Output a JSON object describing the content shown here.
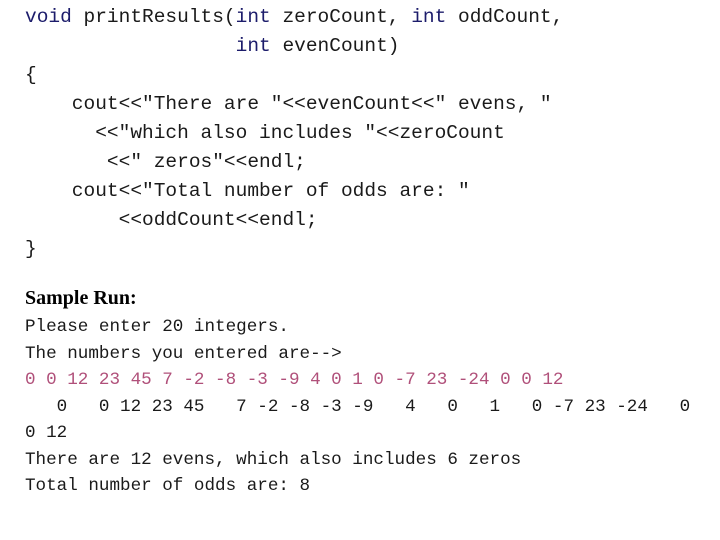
{
  "code": {
    "lines": [
      {
        "parts": [
          {
            "t": "void",
            "kw": true
          },
          {
            "t": " printResults("
          },
          {
            "t": "int",
            "kw": true
          },
          {
            "t": " zeroCount, "
          },
          {
            "t": "int",
            "kw": true
          },
          {
            "t": " oddCount,"
          }
        ]
      },
      {
        "parts": [
          {
            "t": "                  "
          },
          {
            "t": "int",
            "kw": true
          },
          {
            "t": " evenCount)"
          }
        ]
      },
      {
        "parts": [
          {
            "t": "{"
          }
        ]
      },
      {
        "parts": [
          {
            "t": "    cout<<\"There are \"<<evenCount<<\" evens, \""
          }
        ]
      },
      {
        "parts": [
          {
            "t": "      <<\"which also includes \"<<zeroCount"
          }
        ]
      },
      {
        "parts": [
          {
            "t": "       <<\" zeros\"<<endl;"
          }
        ]
      },
      {
        "parts": [
          {
            "t": "    cout<<\"Total number of odds are: \""
          }
        ]
      },
      {
        "parts": [
          {
            "t": "        <<oddCount<<endl;"
          }
        ]
      },
      {
        "parts": [
          {
            "t": "}"
          }
        ]
      }
    ]
  },
  "sample_run": {
    "heading": "Sample Run:",
    "lines": [
      {
        "text": "Please enter 20 integers.",
        "input": false
      },
      {
        "text": "The numbers you entered are-->",
        "input": false
      },
      {
        "text": "0 0 12 23 45 7 -2 -8 -3 -9 4 0 1 0 -7 23 -24 0 0 12",
        "input": true
      },
      {
        "text": "   0   0 12 23 45   7 -2 -8 -3 -9   4   0   1   0 -7 23 -24   0",
        "input": false
      },
      {
        "text": "0 12",
        "input": false
      },
      {
        "text": "There are 12 evens, which also includes 6 zeros",
        "input": false
      },
      {
        "text": "Total number of odds are: 8",
        "input": false
      }
    ]
  },
  "colors": {
    "keyword": "#1c1c6b",
    "user_input": "#b0507a",
    "text": "#1a1a1a"
  }
}
